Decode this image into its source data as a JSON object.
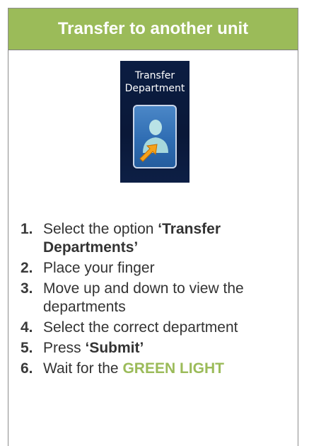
{
  "header": {
    "title": "Transfer to another unit"
  },
  "tile": {
    "label": "Transfer\nDepartment",
    "icon": "user-transfer-icon"
  },
  "steps": [
    {
      "num": "1.",
      "text": "Select the option ",
      "bold": "‘Transfer Departments’"
    },
    {
      "num": "2.",
      "text": "Place your finger"
    },
    {
      "num": "3.",
      "text": "Move up and down to view the departments"
    },
    {
      "num": "4.",
      "text": "Select the correct department"
    },
    {
      "num": "5.",
      "text": "Press ",
      "bold": "‘Submit’"
    },
    {
      "num": "6.",
      "text": "Wait for the ",
      "green": "GREEN LIGHT"
    }
  ],
  "colors": {
    "header_bg": "#9bbb59",
    "accent_green": "#9bbb59",
    "tile_bg": "#0b1d42",
    "tile_button": "#3a78bd"
  }
}
